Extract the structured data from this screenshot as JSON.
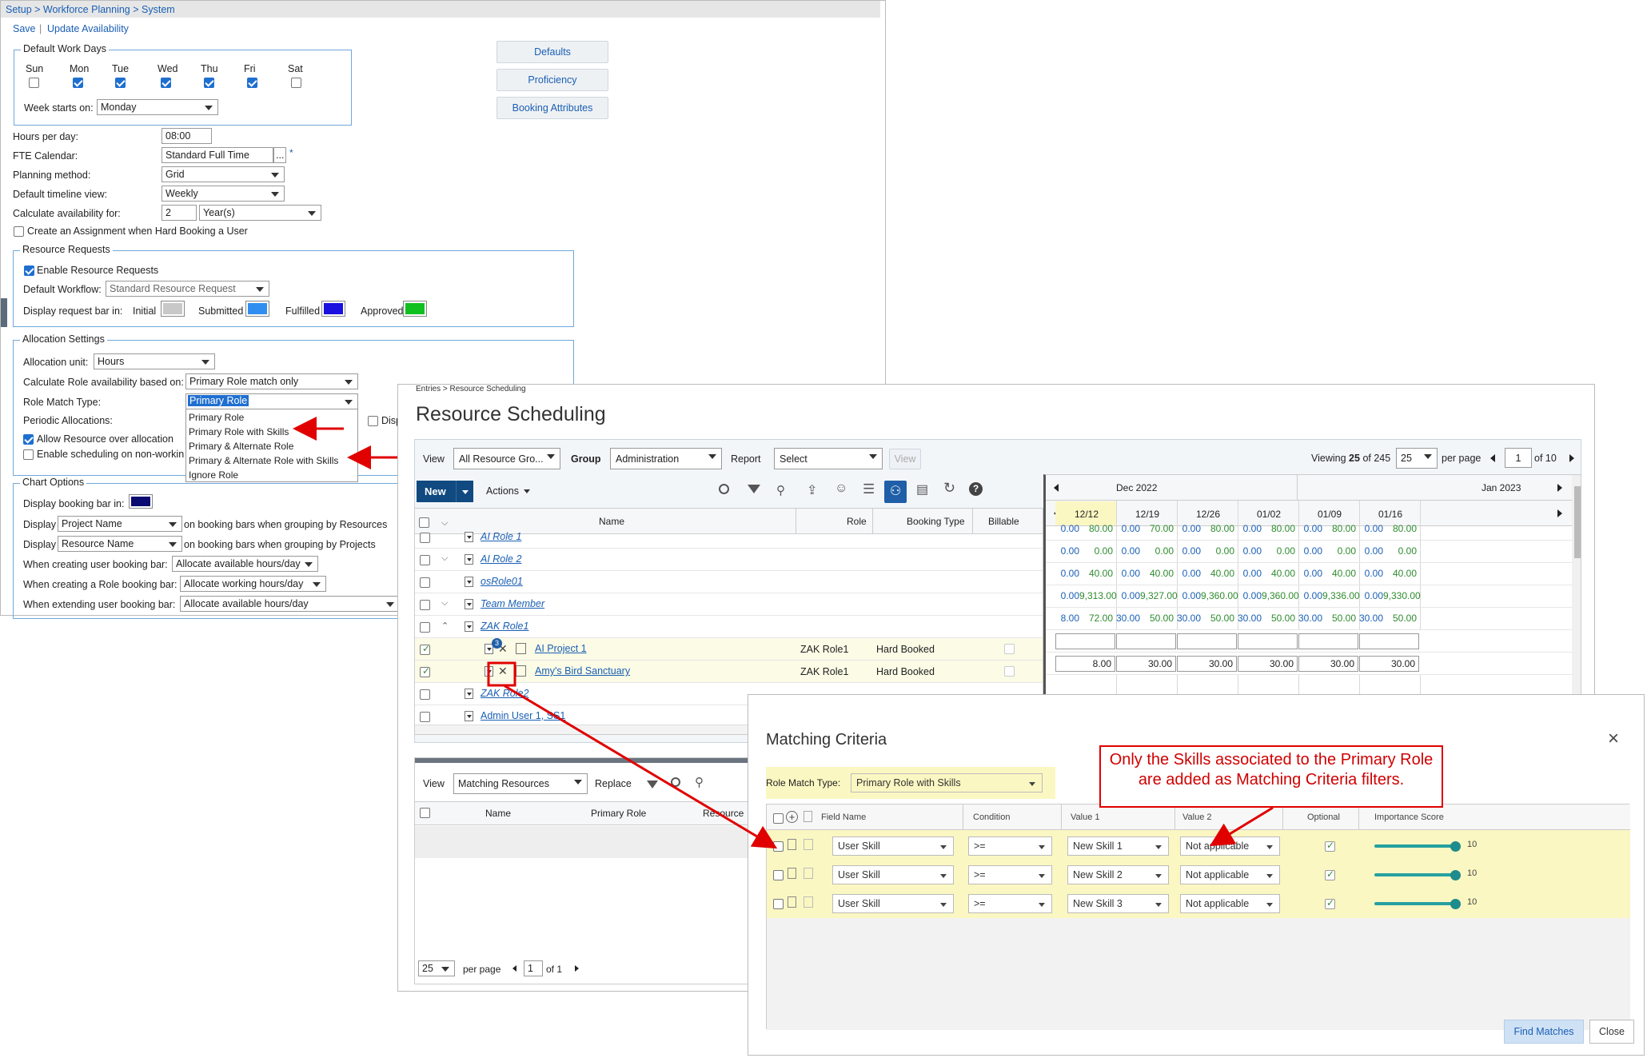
{
  "setup": {
    "breadcrumb": "Setup > Workforce Planning > System",
    "save": "Save",
    "sep": "|",
    "update": "Update Availability",
    "work_days_title": "Default Work Days",
    "days": [
      "Sun",
      "Mon",
      "Tue",
      "Wed",
      "Thu",
      "Fri",
      "Sat"
    ],
    "days_checked": [
      false,
      true,
      true,
      true,
      true,
      true,
      false
    ],
    "week_starts_label": "Week starts on:",
    "week_starts_value": "Monday",
    "buttons": [
      "Defaults",
      "Proficiency",
      "Booking Attributes"
    ],
    "hours_label": "Hours per day:",
    "hours_value": "08:00",
    "fte_label": "FTE Calendar:",
    "fte_value": "Standard Full Time",
    "fte_btn": "...",
    "required": "*",
    "planning_label": "Planning method:",
    "planning_value": "Grid",
    "timeline_label": "Default timeline view:",
    "timeline_value": "Weekly",
    "calc_label": "Calculate availability for:",
    "calc_num": "2",
    "calc_unit": "Year(s)",
    "create_assign": "Create an Assignment when Hard Booking a User",
    "rr_title": "Resource Requests",
    "enable_rr": "Enable Resource Requests",
    "workflow_label": "Default Workflow:",
    "workflow_value": "Standard Resource Request",
    "display_bar_label": "Display request bar in:",
    "bar_states": [
      "Initial",
      "Submitted",
      "Fulfilled",
      "Approved"
    ],
    "bar_colors": [
      "#c8c8c8",
      "#2f8ef0",
      "#1a10e0",
      "#10c020"
    ],
    "alloc_title": "Allocation Settings",
    "alloc_unit_label": "Allocation unit:",
    "alloc_unit_value": "Hours",
    "calc_role_label": "Calculate Role availability based on:",
    "calc_role_value": "Primary Role match only",
    "role_match_label": "Role Match Type:",
    "role_match_value": "Primary Role",
    "role_options": [
      "Primary Role",
      "Primary Role with Skills",
      "Primary & Alternate Role",
      "Primary & Alternate Role with Skills",
      "Ignore Role"
    ],
    "periodic_label": "Periodic Allocations:",
    "allow_over": "Allow Resource over allocation",
    "enable_non": "Enable scheduling on non-workin",
    "disp_partial": "Disp",
    "chart_title": "Chart Options",
    "display_booking": "Display booking bar in:",
    "booking_color": "#0a0a70",
    "display_word": "Display",
    "disp1_value": "Project Name",
    "disp1_text": "on booking bars when grouping by Resources",
    "disp2_value": "Resource Name",
    "disp2_text": "on booking bars when grouping by Projects",
    "creating_user_label": "When creating user booking bar:",
    "creating_user_value": "Allocate available hours/day",
    "creating_role_label": "When creating a Role booking bar:",
    "creating_role_value": "Allocate working hours/day",
    "extending_label": "When extending user booking bar:",
    "extending_value": "Allocate available hours/day"
  },
  "scheduling": {
    "breadcrumb": "Entries > Resource Scheduling",
    "title": "Resource Scheduling",
    "view_label": "View",
    "view_value": "All Resource Gro...",
    "group_label": "Group",
    "group_value": "Administration",
    "report_label": "Report",
    "report_value": "Select",
    "view_btn": "View",
    "viewing_prefix": "Viewing",
    "viewing_count": "25",
    "viewing_of": "of 245",
    "per_page_value": "25",
    "per_page_label": "per page",
    "page_value": "1",
    "page_of": "of 10",
    "new_btn": "New",
    "actions_btn": "Actions",
    "months": [
      "Dec 2022",
      "Jan 2023"
    ],
    "columns": [
      "Name",
      "Role",
      "Booking Type",
      "Billable"
    ],
    "weeks": [
      "12/12",
      "12/19",
      "12/26",
      "01/02",
      "01/09",
      "01/16"
    ],
    "rows": [
      {
        "name": "AI Role 1",
        "italic": true,
        "role": "",
        "booking": "",
        "check": false,
        "vals": [
          [
            "0.00",
            "80.00"
          ],
          [
            "0.00",
            "70.00"
          ],
          [
            "0.00",
            "80.00"
          ],
          [
            "0.00",
            "80.00"
          ],
          [
            "0.00",
            "80.00"
          ],
          [
            "0.00",
            "80.00"
          ]
        ]
      },
      {
        "name": "AI Role 2",
        "italic": true,
        "role": "",
        "booking": "",
        "check": false,
        "vals": [
          [
            "0.00",
            "0.00"
          ],
          [
            "0.00",
            "0.00"
          ],
          [
            "0.00",
            "0.00"
          ],
          [
            "0.00",
            "0.00"
          ],
          [
            "0.00",
            "0.00"
          ],
          [
            "0.00",
            "0.00"
          ]
        ]
      },
      {
        "name": "osRole01",
        "italic": true,
        "role": "",
        "booking": "",
        "check": false,
        "vals": [
          [
            "0.00",
            "40.00"
          ],
          [
            "0.00",
            "40.00"
          ],
          [
            "0.00",
            "40.00"
          ],
          [
            "0.00",
            "40.00"
          ],
          [
            "0.00",
            "40.00"
          ],
          [
            "0.00",
            "40.00"
          ]
        ]
      },
      {
        "name": "Team Member",
        "italic": true,
        "role": "",
        "booking": "",
        "check": false,
        "vals": [
          [
            "0.00",
            "9,313.00"
          ],
          [
            "0.00",
            "9,327.00"
          ],
          [
            "0.00",
            "9,360.00"
          ],
          [
            "0.00",
            "9,360.00"
          ],
          [
            "0.00",
            "9,336.00"
          ],
          [
            "0.00",
            "9,330.00"
          ]
        ]
      },
      {
        "name": "ZAK Role1",
        "italic": true,
        "role": "",
        "booking": "",
        "check": false,
        "vals": [
          [
            "8.00",
            "72.00"
          ],
          [
            "30.00",
            "50.00"
          ],
          [
            "30.00",
            "50.00"
          ],
          [
            "30.00",
            "50.00"
          ],
          [
            "30.00",
            "50.00"
          ],
          [
            "30.00",
            "50.00"
          ]
        ]
      },
      {
        "name": "AI Project 1",
        "italic": false,
        "role": "ZAK Role1",
        "booking": "Hard Booked",
        "check": true,
        "vals": []
      },
      {
        "name": "Amy's Bird Sanctuary",
        "italic": false,
        "role": "ZAK Role1",
        "booking": "Hard Booked",
        "check": true,
        "vals": [
          [
            "",
            "8.00"
          ],
          [
            "",
            "30.00"
          ],
          [
            "",
            "30.00"
          ],
          [
            "",
            "30.00"
          ],
          [
            "",
            "30.00"
          ],
          [
            "",
            "30.00"
          ]
        ]
      },
      {
        "name": "ZAK Role2",
        "italic": true,
        "role": "",
        "booking": "",
        "check": false,
        "vals": []
      },
      {
        "name": "Admin User 1, SS1",
        "italic": false,
        "role": "",
        "booking": "",
        "check": false,
        "vals": []
      }
    ],
    "badge": "3",
    "bottom_view_label": "View",
    "bottom_view_value": "Matching Resources",
    "replace_label": "Replace",
    "bottom_cols": [
      "Name",
      "Primary Role",
      "Resource"
    ],
    "bottom_per_page": "25",
    "bottom_per_label": "per page",
    "bottom_page": "1",
    "bottom_of": "of 1"
  },
  "dialog": {
    "title": "Matching Criteria",
    "close_x": "×",
    "role_match_label": "Role Match Type:",
    "role_match_value": "Primary Role with Skills",
    "columns": [
      "Field Name",
      "Condition",
      "Value 1",
      "Value 2",
      "Optional",
      "Importance Score"
    ],
    "rows": [
      {
        "field": "User Skill",
        "cond": ">=",
        "v1": "New Skill 1",
        "v2": "Not applicable",
        "score": "10",
        "score_fraction": 1.0
      },
      {
        "field": "User Skill",
        "cond": ">=",
        "v1": "New Skill 2",
        "v2": "Not applicable",
        "score": "10",
        "score_fraction": 1.0
      },
      {
        "field": "User Skill",
        "cond": ">=",
        "v1": "New Skill 3",
        "v2": "Not applicable",
        "score": "10",
        "score_fraction": 1.0
      }
    ],
    "find_btn": "Find Matches",
    "close_btn": "Close"
  },
  "annotation": {
    "callout": "Only the Skills associated to the Primary Role are added as Matching Criteria filters."
  },
  "colors": {
    "link": "#1a5fb4",
    "highlight": "#fbf7c2",
    "arrow": "#e00000",
    "nav_blue": "#1f6fd0"
  }
}
